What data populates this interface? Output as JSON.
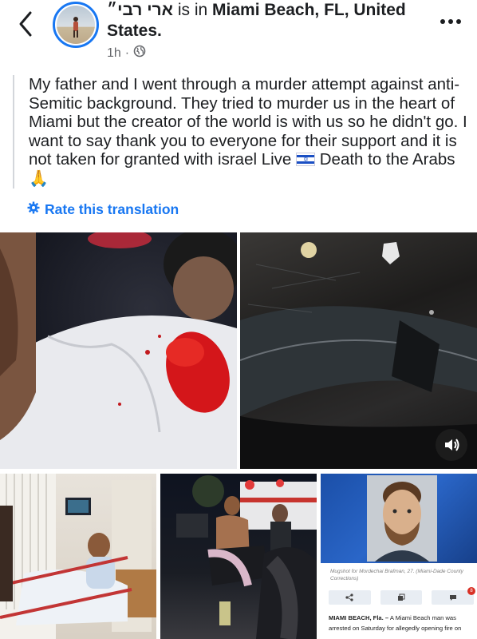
{
  "header": {
    "name": "ארי רבי״",
    "location_text": "is in",
    "location": "Miami Beach, FL, United States.",
    "time": "1h",
    "dot": "·",
    "audience_icon": "globe-icon",
    "back_icon": "chevron-left-icon",
    "more_icon": "more-dots-icon"
  },
  "post": {
    "text": "My father and I went through a murder attempt against anti-Semitic background. They tried to murder us in the heart of Miami but the creator of the world is with us so he didn't go. I want to say thank you to everyone for their support and it is not taken for granted with israel Live",
    "text_end": "Death to the Arabs",
    "flag_icon": "israel-flag-icon",
    "emoji": "🙏"
  },
  "translation": {
    "label": "Rate this translation",
    "icon": "gear-icon"
  },
  "media": {
    "sound_icon": "speaker-icon",
    "news": {
      "caption": "Mugshot for Mordechai Brafman, 27. (Miami-Dade County Corrections)",
      "dateline": "MIAMI BEACH, Fla. –",
      "body": "A Miami Beach man was arrested on Saturday for allegedly opening fire on",
      "share_icons": [
        "share-icon",
        "copy-icon",
        "comment-icon"
      ],
      "badge": "8"
    }
  },
  "colors": {
    "accent": "#1877f2",
    "text": "#1c1e21",
    "muted": "#65676b"
  }
}
